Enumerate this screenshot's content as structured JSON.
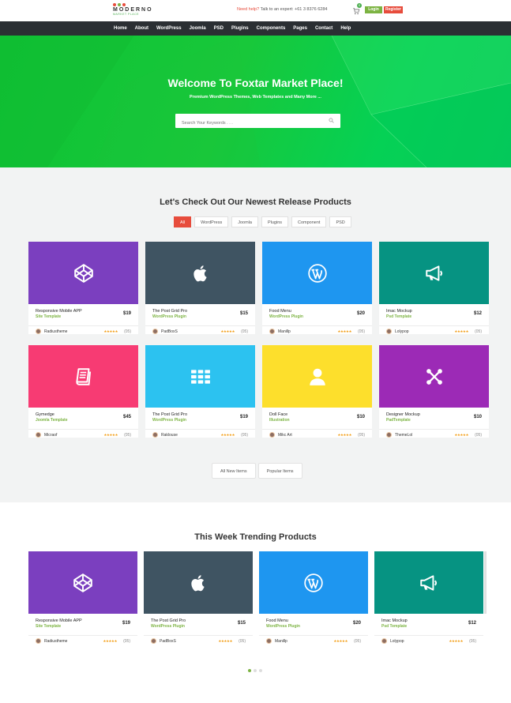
{
  "brand": {
    "name": "MODERNO",
    "tagline": "MARKET PLACE",
    "dot_colors": [
      "#e74c3c",
      "#7cb342",
      "#e74c3c"
    ]
  },
  "topbar": {
    "help_label": "Need help?",
    "help_text": "Talk to an expert: +61 3 8376 6284",
    "cart_count": "0",
    "login": "Login",
    "register": "Register"
  },
  "nav": [
    "Home",
    "About",
    "WordPress",
    "Joomla",
    "PSD",
    "Plugins",
    "Components",
    "Pages",
    "Contact",
    "Help"
  ],
  "hero": {
    "title": "Welcome To Foxtar Market Place!",
    "subtitle": "Premium WordPress Themes, Web Templates and Many More ...",
    "search_placeholder": "Search Your Keywords . . ."
  },
  "newest": {
    "title": "Let's Check Out Our Newest Release Products",
    "filters": [
      "All",
      "WordPress",
      "Joomla",
      "Plugins",
      "Component",
      "PSD"
    ],
    "active_filter": "All",
    "products": [
      {
        "title": "Responsive Mobile APP",
        "category": "Site Template",
        "price": "$19",
        "author": "Radiustheme",
        "rating": "★★★★★",
        "reviews": "(05)",
        "color": "#7b3fbf",
        "icon": "codepen-icon"
      },
      {
        "title": "The Post Grid Pro",
        "category": "WordPress Plugin",
        "price": "$15",
        "author": "PadBoxS",
        "rating": "★★★★★",
        "reviews": "(05)",
        "color": "#3f5462",
        "icon": "apple-icon"
      },
      {
        "title": "Food Menu",
        "category": "WordPress Plugin",
        "price": "$20",
        "author": "Manillp",
        "rating": "★★★★★",
        "reviews": "(05)",
        "color": "#1e96f0",
        "icon": "wordpress-icon"
      },
      {
        "title": "Imac Mockup",
        "category": "Psd Template",
        "price": "$12",
        "author": "Lolypop",
        "rating": "★★★★★",
        "reviews": "(05)",
        "color": "#069382",
        "icon": "megaphone-icon"
      },
      {
        "title": "Gymedge",
        "category": "Joomla Template",
        "price": "$45",
        "author": "Micraof",
        "rating": "★★★★★",
        "reviews": "(05)",
        "color": "#f73b73",
        "icon": "book-icon"
      },
      {
        "title": "The Post Grid Pro",
        "category": "WordPress Plugin",
        "price": "$19",
        "author": "Raklouse",
        "rating": "★★★★★",
        "reviews": "(05)",
        "color": "#2cc2f0",
        "icon": "grid-icon"
      },
      {
        "title": "Doll Face",
        "category": "Illustration",
        "price": "$10",
        "author": "Mikc Art",
        "rating": "★★★★★",
        "reviews": "(05)",
        "color": "#fddf2c",
        "icon": "user-icon"
      },
      {
        "title": "Designer Mockup",
        "category": "PadTemplate",
        "price": "$10",
        "author": "ThemeLol",
        "rating": "★★★★★",
        "reviews": "(05)",
        "color": "#9c2ab6",
        "icon": "joomla-icon"
      }
    ],
    "buttons": [
      "All New Items",
      "Popular Items"
    ]
  },
  "trending": {
    "title": "This Week Trending Products",
    "products": [
      {
        "title": "Responsive Mobile APP",
        "category": "Site Template",
        "price": "$19",
        "author": "Radiustheme",
        "rating": "★★★★★",
        "reviews": "(05)",
        "color": "#7b3fbf",
        "icon": "codepen-icon"
      },
      {
        "title": "The Post Grid Pro",
        "category": "WordPress Plugin",
        "price": "$15",
        "author": "PadBoxS",
        "rating": "★★★★★",
        "reviews": "(05)",
        "color": "#3f5462",
        "icon": "apple-icon"
      },
      {
        "title": "Food Menu",
        "category": "WordPress Plugin",
        "price": "$20",
        "author": "Manillp",
        "rating": "★★★★★",
        "reviews": "(05)",
        "color": "#1e96f0",
        "icon": "wordpress-icon"
      },
      {
        "title": "Imac Mockup",
        "category": "Psd Template",
        "price": "$12",
        "author": "Lolypop",
        "rating": "★★★★★",
        "reviews": "(05)",
        "color": "#069382",
        "icon": "megaphone-icon"
      }
    ],
    "carousel_pages": 3,
    "carousel_active": 0
  }
}
